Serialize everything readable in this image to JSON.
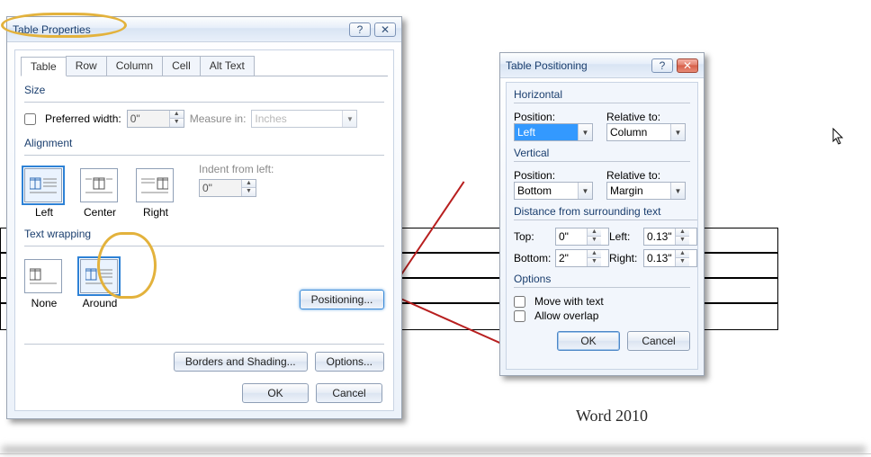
{
  "caption": "Word 2010",
  "table_properties": {
    "title": "Table Properties",
    "tabs": [
      "Table",
      "Row",
      "Column",
      "Cell",
      "Alt Text"
    ],
    "active_tab": "Table",
    "size": {
      "group": "Size",
      "pref_width_label": "Preferred width:",
      "pref_width_value": "0\"",
      "measure_in_label": "Measure in:",
      "measure_in_value": "Inches"
    },
    "alignment": {
      "group": "Alignment",
      "options": {
        "left": "Left",
        "center": "Center",
        "right": "Right"
      },
      "selected": "left",
      "indent_label": "Indent from left:",
      "indent_value": "0\""
    },
    "wrap": {
      "group": "Text wrapping",
      "options": {
        "none": "None",
        "around": "Around"
      },
      "selected": "around",
      "positioning_btn": "Positioning..."
    },
    "borders_btn": "Borders and Shading...",
    "options_btn": "Options...",
    "ok": "OK",
    "cancel": "Cancel"
  },
  "positioning": {
    "title": "Table Positioning",
    "horizontal": {
      "group": "Horizontal",
      "position_label": "Position:",
      "position_value": "Left",
      "relative_label": "Relative to:",
      "relative_value": "Column"
    },
    "vertical": {
      "group": "Vertical",
      "position_label": "Position:",
      "position_value": "Bottom",
      "relative_label": "Relative to:",
      "relative_value": "Margin"
    },
    "distance": {
      "group": "Distance from surrounding text",
      "top_label": "Top:",
      "top_value": "0\"",
      "bottom_label": "Bottom:",
      "bottom_value": "2\"",
      "left_label": "Left:",
      "left_value": "0.13\"",
      "right_label": "Right:",
      "right_value": "0.13\""
    },
    "options": {
      "group": "Options",
      "move_with_text": "Move with text",
      "allow_overlap": "Allow overlap"
    },
    "ok": "OK",
    "cancel": "Cancel"
  }
}
